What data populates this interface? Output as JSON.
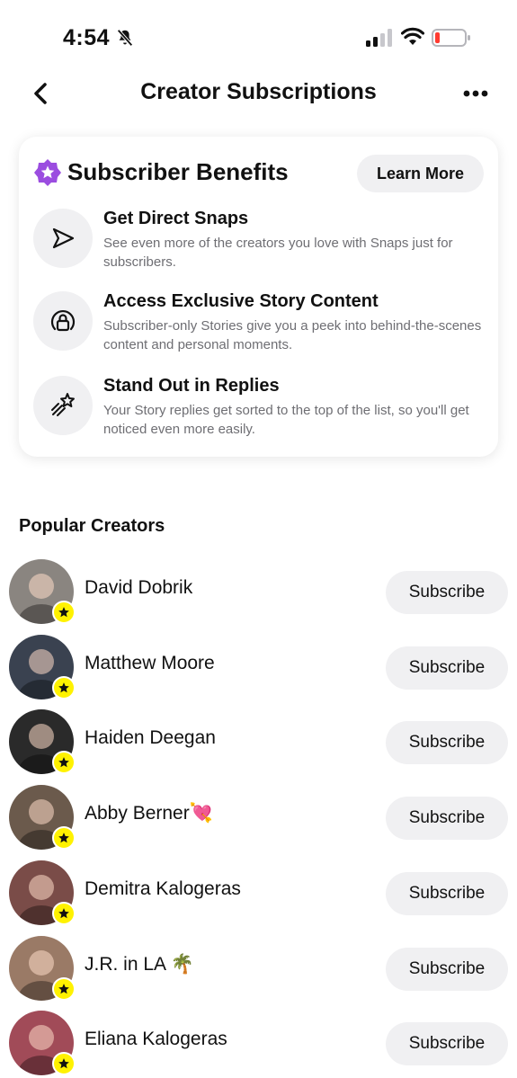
{
  "status_bar": {
    "time": "4:54"
  },
  "header": {
    "title": "Creator Subscriptions"
  },
  "benefits": {
    "title": "Subscriber Benefits",
    "learn_more_label": "Learn More",
    "items": [
      {
        "icon": "send-arrow-icon",
        "title": "Get Direct Snaps",
        "desc": "See even more of the creators you love with Snaps just for subscribers."
      },
      {
        "icon": "lock-story-icon",
        "title": "Access Exclusive Story Content",
        "desc": "Subscriber-only Stories give you a peek into behind-the-scenes content and personal moments."
      },
      {
        "icon": "shooting-star-icon",
        "title": "Stand Out in Replies",
        "desc": "Your Story replies get sorted to the top of the list, so you'll get noticed even more easily."
      }
    ]
  },
  "popular": {
    "title": "Popular Creators",
    "subscribe_label": "Subscribe",
    "creators": [
      {
        "name": "David Dobrik",
        "avatar_color": "#8a8580"
      },
      {
        "name": "Matthew Moore",
        "avatar_color": "#3a4250"
      },
      {
        "name": "Haiden Deegan",
        "avatar_color": "#2a2a2a"
      },
      {
        "name": "Abby Berner💘",
        "avatar_color": "#6b5a4c"
      },
      {
        "name": "Demitra Kalogeras",
        "avatar_color": "#7a4c48"
      },
      {
        "name": "J.R. in LA 🌴",
        "avatar_color": "#9a7a66"
      },
      {
        "name": "Eliana Kalogeras",
        "avatar_color": "#a14b58"
      }
    ]
  },
  "colors": {
    "badge": "#fff200",
    "star_purple": "#9b4de0",
    "battery_low": "#ff3b30"
  }
}
